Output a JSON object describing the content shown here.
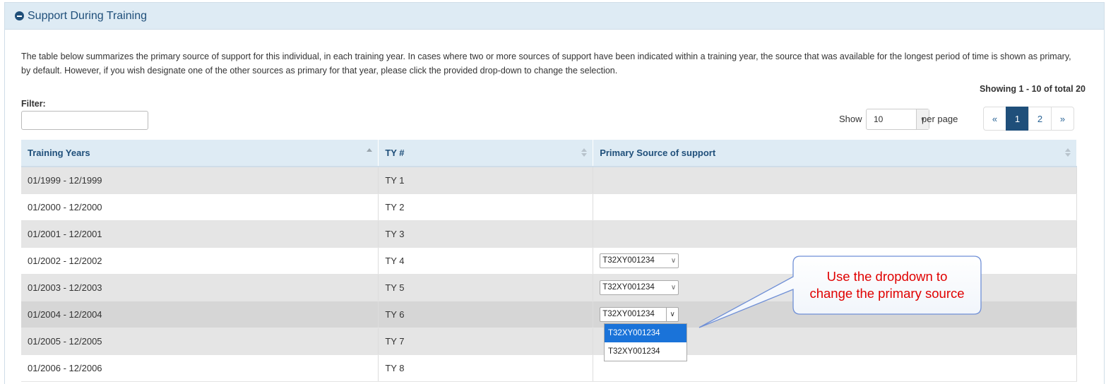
{
  "panel": {
    "title": "Support During Training",
    "icon": "minus-circle-icon"
  },
  "intro_text": "The table below summarizes the primary source of support for this individual, in each training year. In cases where two or more sources of support have been indicated within a training year, the source that was available for the longest period of time is shown as primary, by default. However, if you wish designate one of the other sources as primary for that year, please click the provided drop-down to change the selection.",
  "showing_text": "Showing 1 - 10 of total 20",
  "filter": {
    "label": "Filter:",
    "value": ""
  },
  "per_page": {
    "show_label": "Show",
    "value": "10",
    "suffix_label": "per page"
  },
  "pagination": {
    "prev": "«",
    "pages": [
      "1",
      "2"
    ],
    "active": "1",
    "next": "»"
  },
  "table": {
    "headers": [
      "Training Years",
      "TY #",
      "Primary Source of support"
    ],
    "rows": [
      {
        "years": "01/1999 - 12/1999",
        "ty": "TY 1",
        "source": ""
      },
      {
        "years": "01/2000 - 12/2000",
        "ty": "TY 2",
        "source": ""
      },
      {
        "years": "01/2001 - 12/2001",
        "ty": "TY 3",
        "source": ""
      },
      {
        "years": "01/2002 - 12/2002",
        "ty": "TY 4",
        "source": "T32XY001234"
      },
      {
        "years": "01/2003 - 12/2003",
        "ty": "TY 5",
        "source": "T32XY001234"
      },
      {
        "years": "01/2004 - 12/2004",
        "ty": "TY 6",
        "source": "T32XY001234"
      },
      {
        "years": "01/2005 - 12/2005",
        "ty": "TY 7",
        "source": ""
      },
      {
        "years": "01/2006 - 12/2006",
        "ty": "TY 8",
        "source": ""
      }
    ]
  },
  "dropdown_options": [
    "T32XY001234",
    "T32XY001234"
  ],
  "callout": {
    "line1": "Use the dropdown to",
    "line2": "change the primary source"
  },
  "colors": {
    "header_bg": "#deebf4",
    "brand": "#1f4f7a",
    "callout_text": "#e00000",
    "selected_option": "#1a73d9"
  }
}
